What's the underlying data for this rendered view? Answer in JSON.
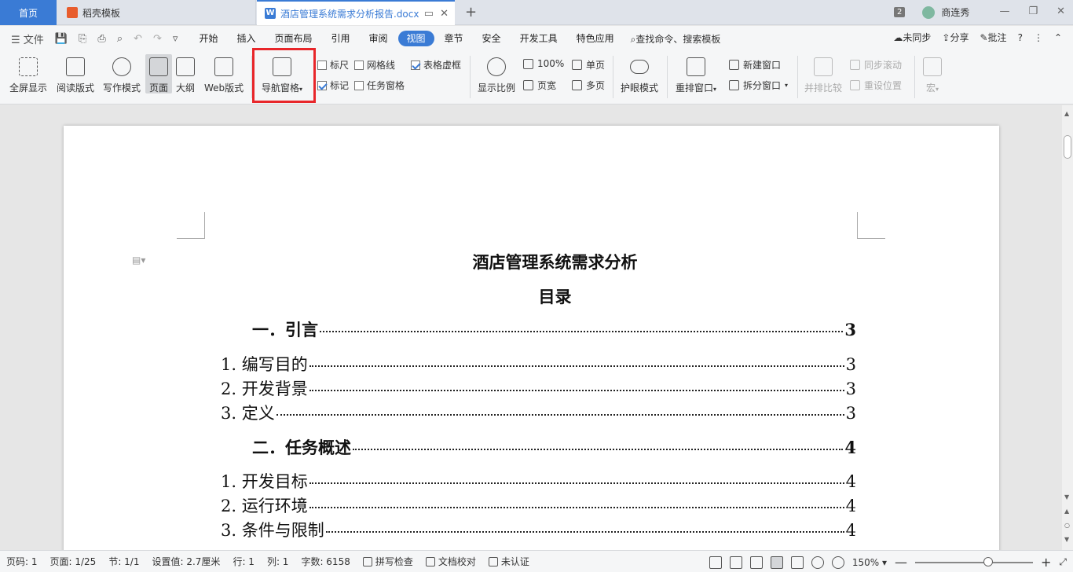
{
  "tabs": {
    "home": "首页",
    "template": "稻壳模板",
    "doc": "酒店管理系统需求分析报告.docx",
    "doc_icon": "W",
    "new_tab": "+"
  },
  "user": {
    "count": "2",
    "name": "商连秀"
  },
  "window_controls": {
    "menu": "☰",
    "minimize": "—",
    "restore": "❐",
    "close": "✕"
  },
  "menubar": {
    "file": "文件",
    "items": [
      "开始",
      "插入",
      "页面布局",
      "引用",
      "审阅",
      "视图",
      "章节",
      "安全",
      "开发工具",
      "特色应用"
    ],
    "active": "视图",
    "search": "查找命令、搜索模板",
    "sync": "未同步",
    "share": "分享",
    "comment": "批注",
    "help": "?"
  },
  "ribbon": {
    "fullscreen": "全屏显示",
    "reading": "阅读版式",
    "writing": "写作模式",
    "page": "页面",
    "outline": "大纲",
    "web": "Web版式",
    "nav_pane": "导航窗格",
    "ruler": "标尺",
    "gridlines": "网格线",
    "table_frame": "表格虚框",
    "marks": "标记",
    "task_pane": "任务窗格",
    "zoom": "显示比例",
    "zoom100": "100%",
    "page_width": "页宽",
    "single_page": "单页",
    "multi_page": "多页",
    "eye_mode": "护眼模式",
    "arrange": "重排窗口",
    "new_window": "新建窗口",
    "split_window": "拆分窗口",
    "compare": "并排比较",
    "sync_scroll": "同步滚动",
    "reset_pos": "重设位置",
    "macro": "宏"
  },
  "checkbox_state": {
    "ruler": false,
    "gridlines": false,
    "table_frame": true,
    "marks": true,
    "task_pane": false
  },
  "document": {
    "title": "酒店管理系统需求分析",
    "toc_title": "目录",
    "toc": [
      {
        "text": "一．引言",
        "page": "3",
        "level": 1
      },
      {
        "text": "1. 编写目的",
        "page": "3",
        "level": 2
      },
      {
        "text": "2. 开发背景",
        "page": "3",
        "level": 2
      },
      {
        "text": "3. 定义",
        "page": "3",
        "level": 2
      },
      {
        "text": "二．任务概述",
        "page": "4",
        "level": 1
      },
      {
        "text": "1. 开发目标",
        "page": "4",
        "level": 2
      },
      {
        "text": "2. 运行环境",
        "page": "4",
        "level": 2
      },
      {
        "text": "3. 条件与限制",
        "page": "4",
        "level": 2
      }
    ]
  },
  "status": {
    "page_num": "页码: 1",
    "pages": "页面: 1/25",
    "section": "节: 1/1",
    "setting": "设置值: 2.7厘米",
    "line": "行: 1",
    "col": "列: 1",
    "words": "字数: 6158",
    "spell": "拼写检查",
    "doc_check": "文档校对",
    "cert": "未认证",
    "zoom": "150%",
    "zoom_value": 0.62
  }
}
